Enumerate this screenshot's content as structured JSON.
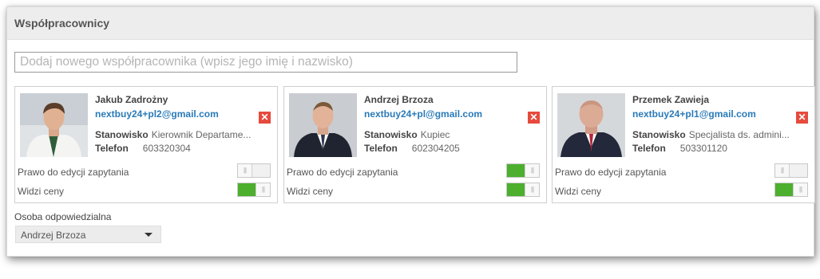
{
  "panel": {
    "title": "Współpracownicy"
  },
  "search": {
    "placeholder": "Dodaj nowego współpracownika (wpisz jego imię i nazwisko)",
    "value": ""
  },
  "labels": {
    "position": "Stanowisko",
    "phone": "Telefon",
    "edit_permission": "Prawo do edycji zapytania",
    "sees_prices": "Widzi ceny",
    "remove_icon": "✕"
  },
  "coworkers": [
    {
      "name": "Jakub Zadrożny",
      "email": "nextbuy24+pl2@gmail.com",
      "position": "Kierownik Departame...",
      "phone": "603320304",
      "edit_permission": false,
      "sees_prices": true,
      "photo_icon": "person-photo"
    },
    {
      "name": "Andrzej Brzoza",
      "email": "nextbuy24+pl@gmail.com",
      "position": "Kupiec",
      "phone": "602304205",
      "edit_permission": true,
      "sees_prices": true,
      "photo_icon": "person-photo"
    },
    {
      "name": "Przemek Zawieja",
      "email": "nextbuy24+pl1@gmail.com",
      "position": "Specjalista ds. admini...",
      "phone": "503301120",
      "edit_permission": false,
      "sees_prices": true,
      "photo_icon": "person-photo"
    }
  ],
  "responsible": {
    "label": "Osoba odpowiedzialna",
    "selected": "Andrzej Brzoza"
  },
  "colors": {
    "toggle_on": "#4caf2e",
    "link": "#2a7ab8",
    "remove": "#e64a3d",
    "header_bg": "#ededed"
  }
}
